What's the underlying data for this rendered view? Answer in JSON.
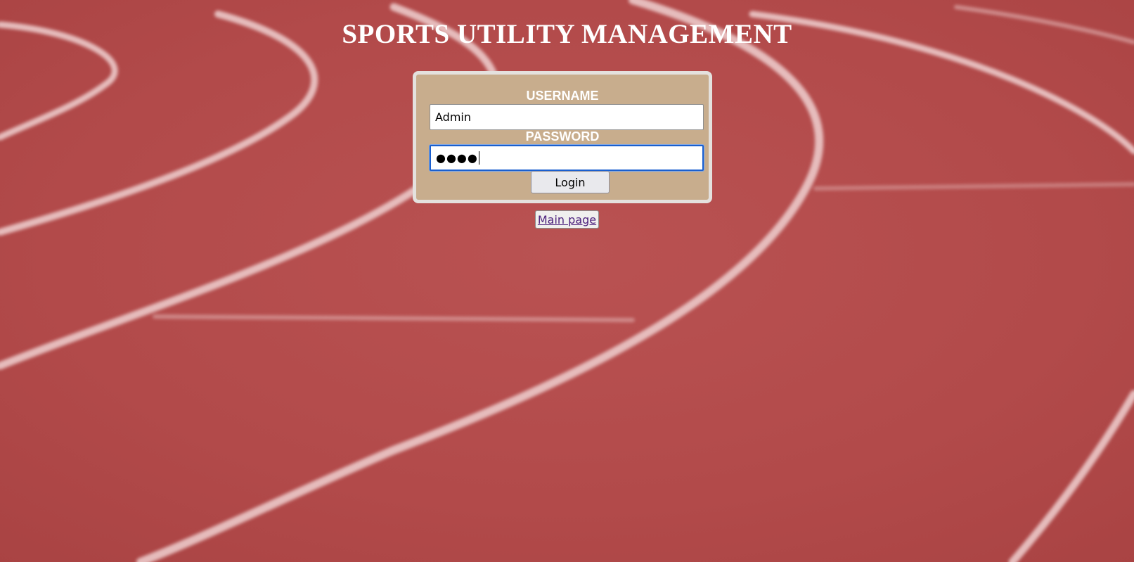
{
  "page": {
    "title": "SPORTS UTILITY MANAGEMENT"
  },
  "login_form": {
    "username_label": "USERNAME",
    "username_value": "Admin",
    "password_label": "PASSWORD",
    "password_masked": "●●●●",
    "login_button_label": "Login"
  },
  "footer": {
    "main_page_link": "Main page"
  },
  "colors": {
    "background_track": "#b24b4b",
    "track_lines": "#e9bfbf",
    "panel_bg": "#c8ad8d",
    "panel_border": "#e4e1de",
    "focus_ring": "#1a5fcf",
    "link": "#4b1f7c"
  }
}
